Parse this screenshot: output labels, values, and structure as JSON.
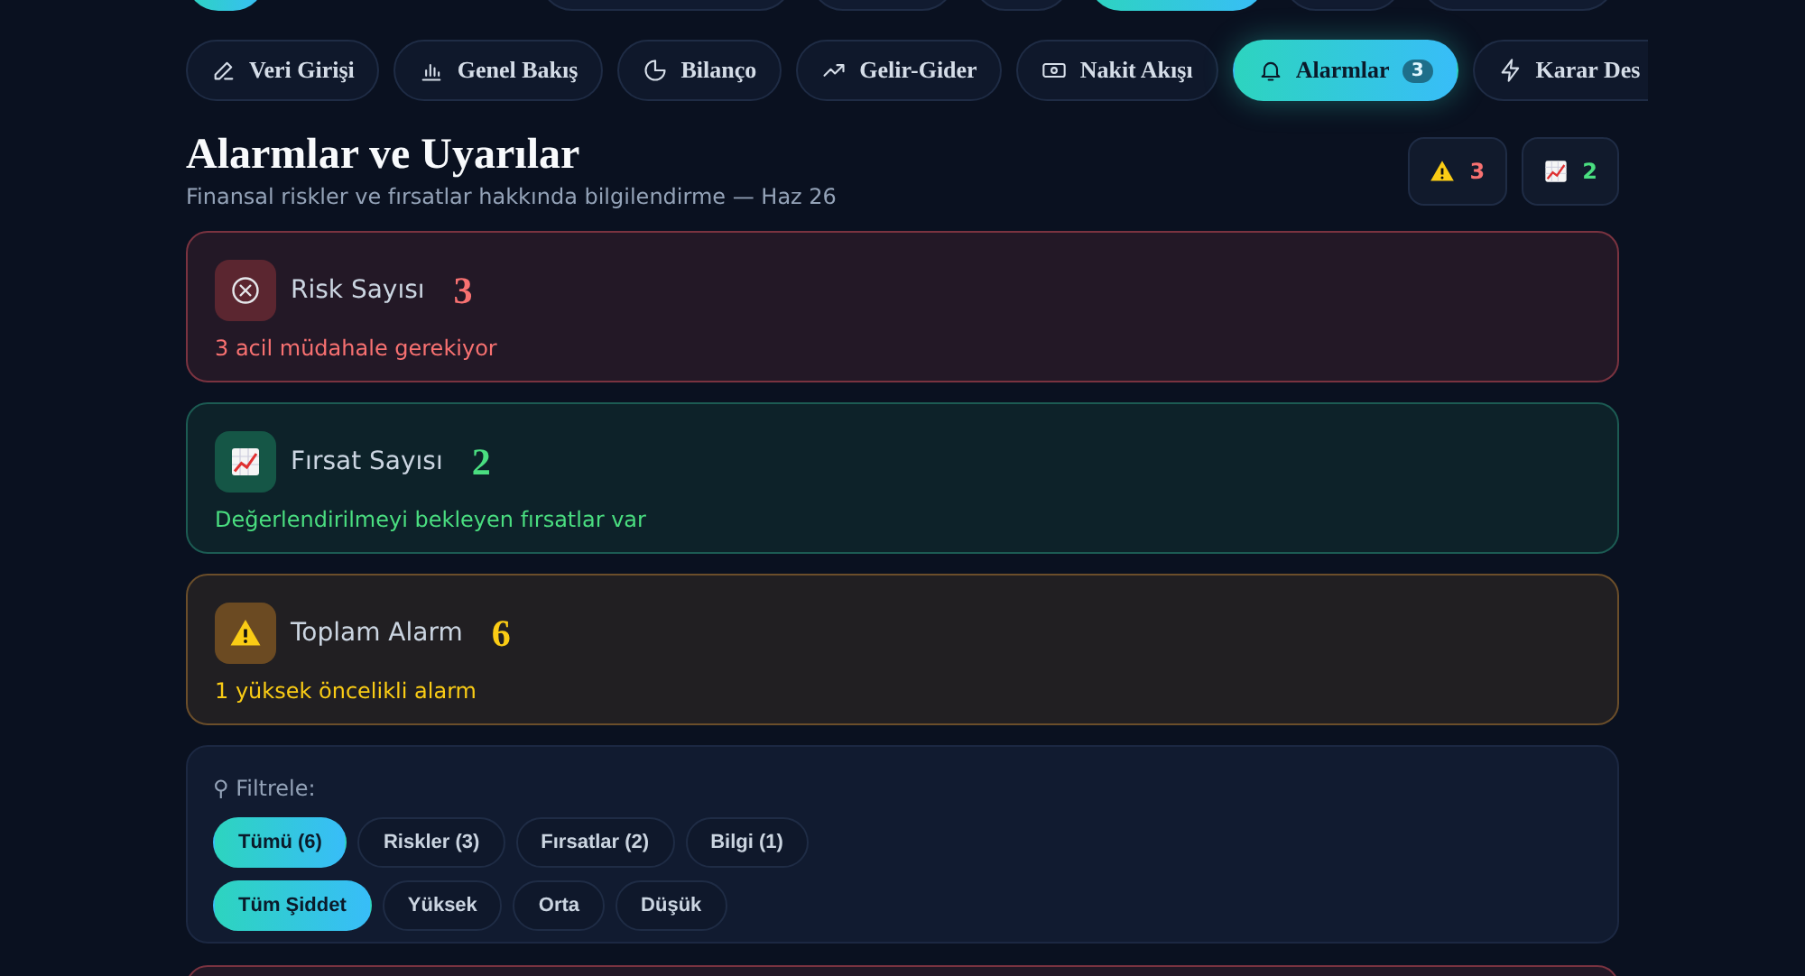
{
  "top_bar": {
    "buttons": [
      {
        "kind": "logo"
      },
      {
        "kind": "plain"
      },
      {
        "kind": "plain"
      },
      {
        "kind": "plain"
      },
      {
        "kind": "accent"
      },
      {
        "kind": "plain"
      },
      {
        "kind": "plain"
      }
    ]
  },
  "nav_tabs": [
    {
      "label": "Veri Girişi",
      "selected": false
    },
    {
      "label": "Genel Bakış",
      "selected": false
    },
    {
      "label": "Bilanço",
      "selected": false
    },
    {
      "label": "Gelir-Gider",
      "selected": false
    },
    {
      "label": "Nakit Akışı",
      "selected": false
    },
    {
      "label": "Alarmlar",
      "badge": "3",
      "selected": true
    },
    {
      "label": "Karar Des",
      "selected": false
    }
  ],
  "header": {
    "title": "Alarmlar ve Uyarılar",
    "subtitle": "Finansal riskler ve fırsatlar hakkında bilgilendirme — Haz 26",
    "badges": [
      {
        "kind": "warning",
        "count": "3",
        "color": "#f87171"
      },
      {
        "kind": "chart",
        "count": "2",
        "color": "#4ade80"
      }
    ]
  },
  "stat_cards": [
    {
      "kind": "risk",
      "label": "Risk Sayısı",
      "value": "3",
      "note": "3 acil müdahale gerekiyor"
    },
    {
      "kind": "opportunity",
      "label": "Fırsat Sayısı",
      "value": "2",
      "note": "Değerlendirilmeyi bekleyen fırsatlar var"
    },
    {
      "kind": "total",
      "label": "Toplam Alarm",
      "value": "6",
      "note": "1 yüksek öncelikli alarm"
    }
  ],
  "filter": {
    "label": "⚲ Filtrele:",
    "type_chips": [
      {
        "label": "Tümü (6)",
        "selected": true
      },
      {
        "label": "Riskler (3)",
        "selected": false
      },
      {
        "label": "Fırsatlar (2)",
        "selected": false
      },
      {
        "label": "Bilgi (1)",
        "selected": false
      }
    ],
    "severity_chips": [
      {
        "label": "Tüm Şiddet",
        "selected": true
      },
      {
        "label": "Yüksek",
        "selected": false
      },
      {
        "label": "Orta",
        "selected": false
      },
      {
        "label": "Düşük",
        "selected": false
      }
    ]
  },
  "alarm_list": [
    {
      "kind": "risk"
    }
  ]
}
